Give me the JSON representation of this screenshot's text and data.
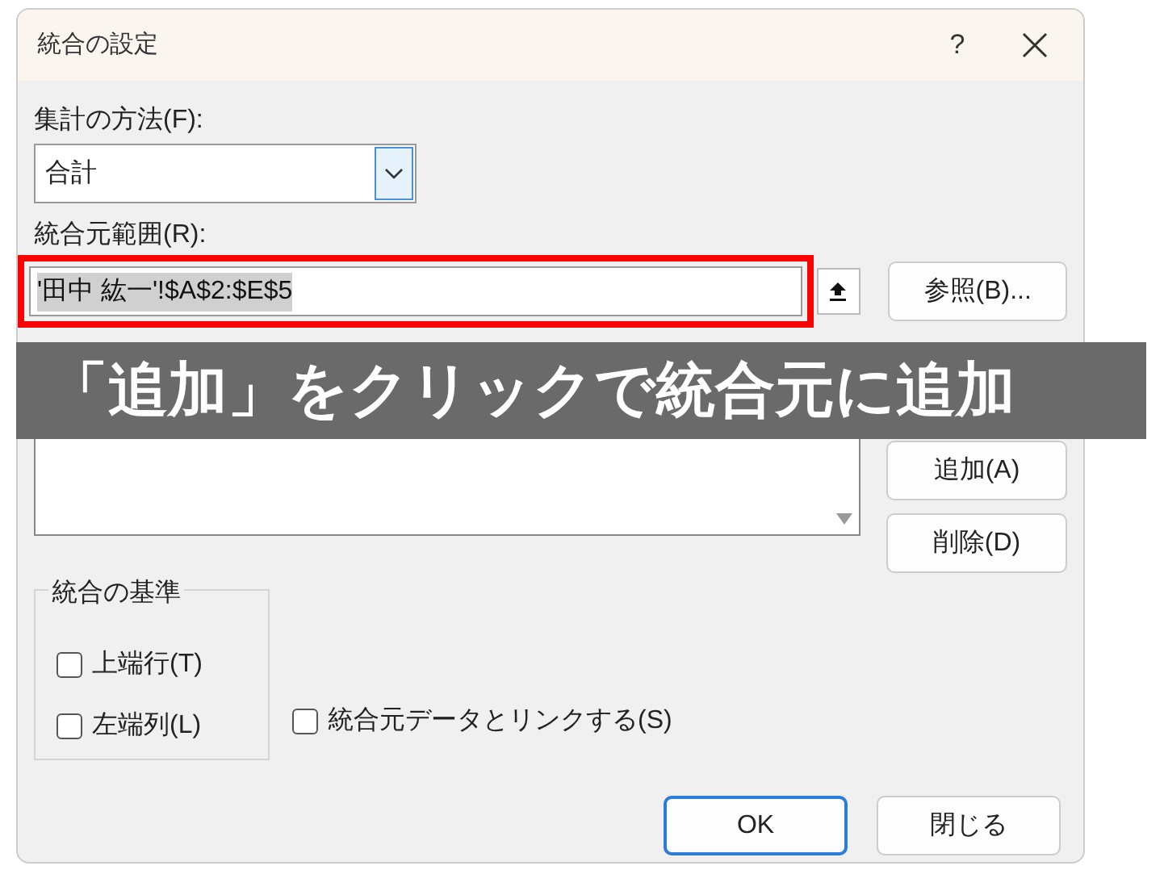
{
  "window": {
    "title": "統合の設定",
    "help": "?"
  },
  "function": {
    "label": "集計の方法(F):",
    "value": "合計"
  },
  "reference": {
    "label": "統合元範囲(R):",
    "value": "'田中 紘一'!$A$2:$E$5",
    "highlighted": true,
    "browse_button": "参照(B)..."
  },
  "sources": {
    "add_button": "追加(A)",
    "delete_button": "削除(D)"
  },
  "labels_group": {
    "title": "統合の基準",
    "options": [
      {
        "label": "上端行(T)",
        "checked": false
      },
      {
        "label": "左端列(L)",
        "checked": false
      }
    ]
  },
  "link_option": {
    "label": "統合元データとリンクする(S)",
    "checked": false
  },
  "buttons": [
    {
      "label": "OK",
      "default": true
    },
    {
      "label": "閉じる",
      "default": false
    }
  ],
  "caption": "「追加」をクリックで統合元に追加"
}
